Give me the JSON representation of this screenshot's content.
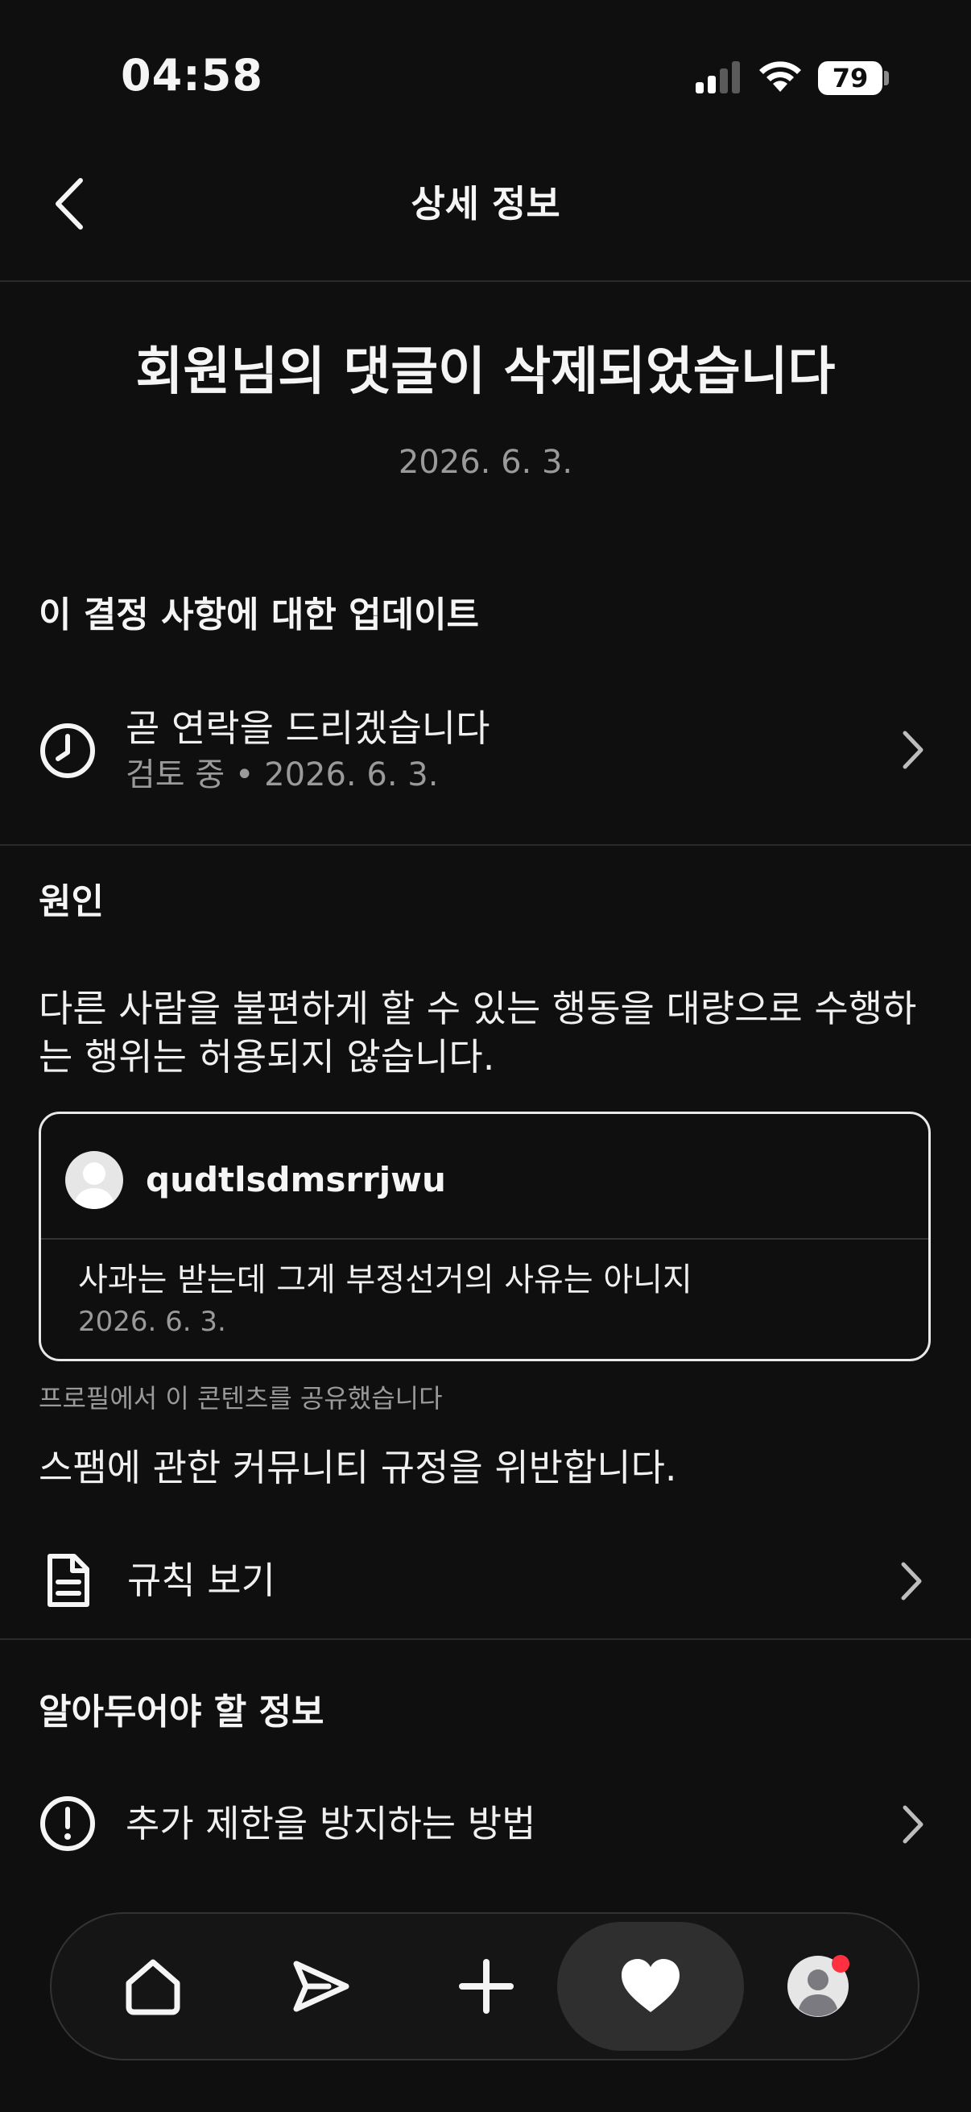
{
  "status_bar": {
    "time": "04:58",
    "battery": "79",
    "icons": [
      "signal-icon",
      "wifi-icon",
      "battery-icon"
    ]
  },
  "header": {
    "title": "상세 정보",
    "back_icon": "chevron-left-icon"
  },
  "notice": {
    "title": "회원님의 댓글이 삭제되었습니다",
    "date": "2026. 6. 3."
  },
  "update_section": {
    "heading": "이 결정 사항에 대한 업데이트",
    "item": {
      "icon": "clock-icon",
      "title": "곧 연락을 드리겠습니다",
      "subtitle": "검토 중 • 2026. 6. 3."
    }
  },
  "reason_section": {
    "heading": "원인",
    "description": "다른 사람을 불편하게 할 수 있는 행동을 대량으로 수행하는 행위는 허용되지 않습니다.",
    "card": {
      "username": "qudtlsdmsrrjwu",
      "comment": "사과는 받는데 그게 부정선거의 사유는 아니지",
      "date": "2026. 6. 3."
    },
    "shared_note": "프로필에서 이 콘텐츠를 공유했습니다",
    "violation": "스팸에 관한 커뮤니티 규정을 위반합니다.",
    "rules_link": {
      "icon": "document-icon",
      "label": "규칙 보기"
    }
  },
  "info_section": {
    "heading": "알아두어야 할 정보",
    "item": {
      "icon": "alert-circle-icon",
      "label": "추가 제한을 방지하는 방법"
    }
  },
  "bottom_nav": {
    "items": [
      {
        "icon": "home-icon"
      },
      {
        "icon": "send-icon"
      },
      {
        "icon": "plus-icon"
      },
      {
        "icon": "heart-icon",
        "active": true
      },
      {
        "icon": "profile-avatar-icon"
      }
    ],
    "colors": {
      "active_bg": "#2f2f2f",
      "badge": "#ff3040"
    }
  }
}
